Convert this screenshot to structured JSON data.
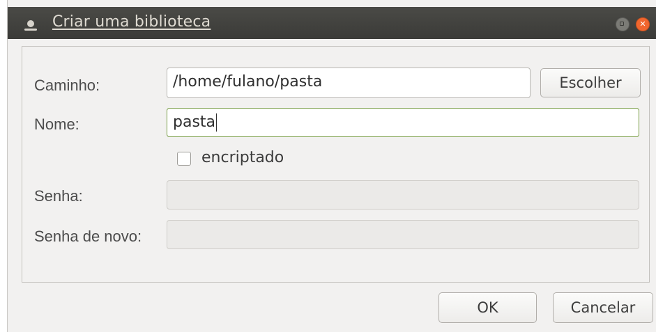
{
  "window": {
    "title": "Criar uma biblioteca"
  },
  "form": {
    "path_label": "Caminho:",
    "path_value": "/home/fulano/pasta",
    "choose_button": "Escolher",
    "name_label": "Nome:",
    "name_value": "pasta",
    "encrypted_label": "encriptado",
    "encrypted_checked": false,
    "password_label": "Senha:",
    "password_value": "",
    "password_again_label": "Senha de novo:",
    "password_again_value": ""
  },
  "buttons": {
    "ok": "OK",
    "cancel": "Cancelar"
  },
  "colors": {
    "titlebar": "#3c3b37",
    "focus_border": "#7a9e48",
    "close_button": "#f0662e"
  }
}
